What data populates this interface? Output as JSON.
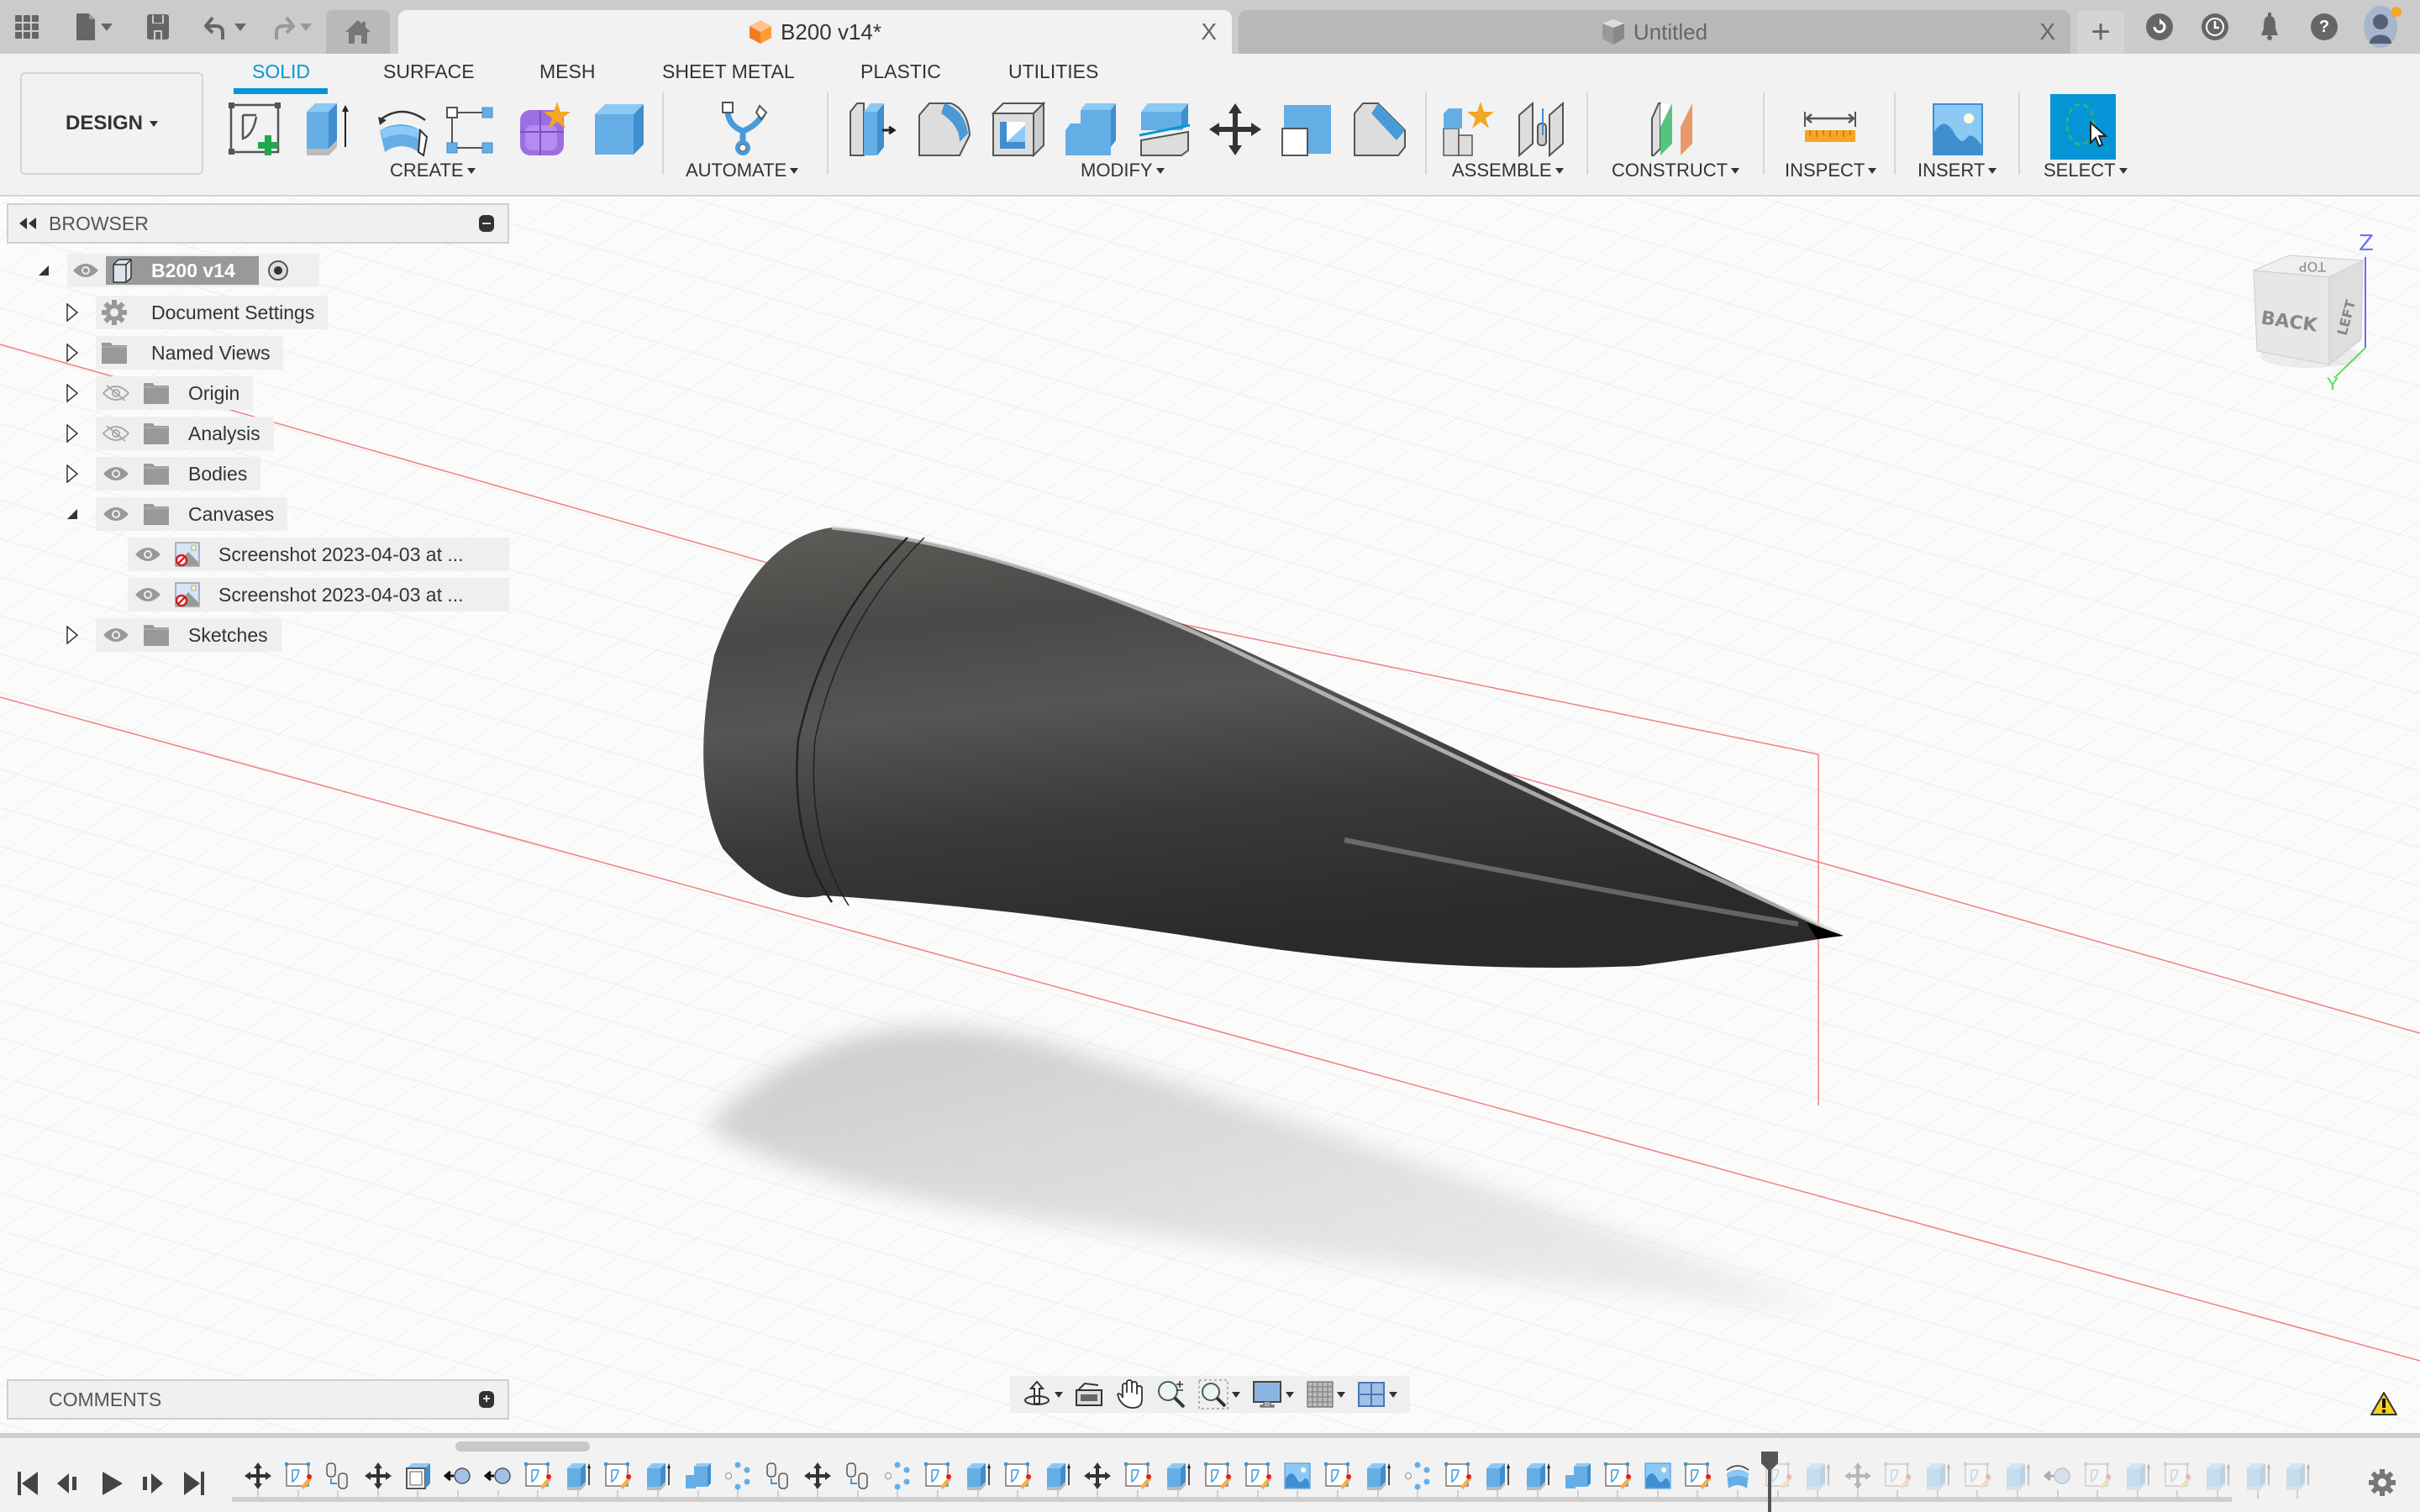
{
  "app": {
    "quick_access": [
      "data-panel-icon",
      "file-icon",
      "save-icon",
      "undo-icon",
      "redo-icon"
    ],
    "home_icon": "home-icon"
  },
  "tabs": [
    {
      "label": "B200 v14*",
      "icon": "design-cube-orange-icon",
      "active": true,
      "close": "X"
    },
    {
      "label": "Untitled",
      "icon": "design-cube-gray-icon",
      "active": false,
      "close": "X"
    }
  ],
  "tab_new": "+",
  "top_right": {
    "extensions": "extensions-icon",
    "job_status": "clock-icon",
    "notifications": "bell-icon",
    "help": "?",
    "profile": "avatar"
  },
  "ribbon": {
    "workspace": "DESIGN",
    "tabs": [
      "SOLID",
      "SURFACE",
      "MESH",
      "SHEET METAL",
      "PLASTIC",
      "UTILITIES"
    ],
    "active_tab": "SOLID",
    "groups": [
      {
        "label": "CREATE",
        "tools": [
          "create-sketch",
          "extrude",
          "revolve",
          "sweep-pattern",
          "form",
          "box"
        ]
      },
      {
        "label": "AUTOMATE",
        "tools": [
          "automate"
        ]
      },
      {
        "label": "MODIFY",
        "tools": [
          "press-pull",
          "fillet",
          "shell",
          "combine",
          "offset-face",
          "move-copy",
          "align",
          "chamfer"
        ]
      },
      {
        "label": "ASSEMBLE",
        "tools": [
          "new-component",
          "joint"
        ]
      },
      {
        "label": "CONSTRUCT",
        "tools": [
          "offset-plane"
        ]
      },
      {
        "label": "INSPECT",
        "tools": [
          "measure"
        ]
      },
      {
        "label": "INSERT",
        "tools": [
          "insert-canvas"
        ]
      },
      {
        "label": "SELECT",
        "tools": [
          "select"
        ]
      }
    ],
    "accent": "#0696d7"
  },
  "browser": {
    "title": "BROWSER",
    "root": {
      "label": "B200 v14"
    },
    "items": [
      {
        "label": "Document Settings",
        "icon": "gear-icon",
        "visible": null,
        "expanded": false
      },
      {
        "label": "Named Views",
        "icon": "folder-icon",
        "visible": null,
        "expanded": false
      },
      {
        "label": "Origin",
        "icon": "folder-icon",
        "visible": false,
        "expanded": false
      },
      {
        "label": "Analysis",
        "icon": "folder-icon",
        "visible": false,
        "expanded": false
      },
      {
        "label": "Bodies",
        "icon": "folder-icon",
        "visible": true,
        "expanded": false
      },
      {
        "label": "Canvases",
        "icon": "folder-icon",
        "visible": true,
        "expanded": true
      },
      {
        "label": "Screenshot 2023-04-03 at ...",
        "icon": "canvas-image-icon",
        "visible": true,
        "child": true
      },
      {
        "label": "Screenshot 2023-04-03 at ...",
        "icon": "canvas-image-icon",
        "visible": true,
        "child": true
      },
      {
        "label": "Sketches",
        "icon": "folder-icon",
        "visible": true,
        "expanded": false
      }
    ]
  },
  "viewcube": {
    "front": "BACK",
    "side": "LEFT",
    "top": "TOP",
    "axis_z": "Z",
    "axis_y": "Y"
  },
  "comments": {
    "title": "COMMENTS"
  },
  "nav_toolbar": [
    "orbit",
    "look-at",
    "pan",
    "zoom",
    "fit",
    "display-settings",
    "grid-snaps",
    "viewports"
  ],
  "timeline": {
    "controls": [
      "go-to-start",
      "step-back",
      "play",
      "step-forward",
      "go-to-end"
    ],
    "features": [
      "move",
      "sketch",
      "derive",
      "move",
      "shell",
      "joint",
      "joint",
      "sketch",
      "extrude",
      "sketch",
      "extrude",
      "combine",
      "pattern",
      "derive",
      "move",
      "derive",
      "pattern",
      "sketch",
      "extrude",
      "sketch",
      "extrude",
      "move",
      "sketch",
      "extrude",
      "sketch",
      "sketch",
      "canvas",
      "sketch",
      "extrude",
      "pattern",
      "sketch",
      "extrude",
      "extrude",
      "combine",
      "sketch",
      "canvas",
      "sketch",
      "revolve",
      "sketch",
      "extrude",
      "move",
      "sketch",
      "extrude",
      "sketch",
      "extrude",
      "joint",
      "sketch",
      "extrude",
      "sketch",
      "extrude",
      "extrude",
      "extrude"
    ],
    "marker_after_index": 37
  }
}
